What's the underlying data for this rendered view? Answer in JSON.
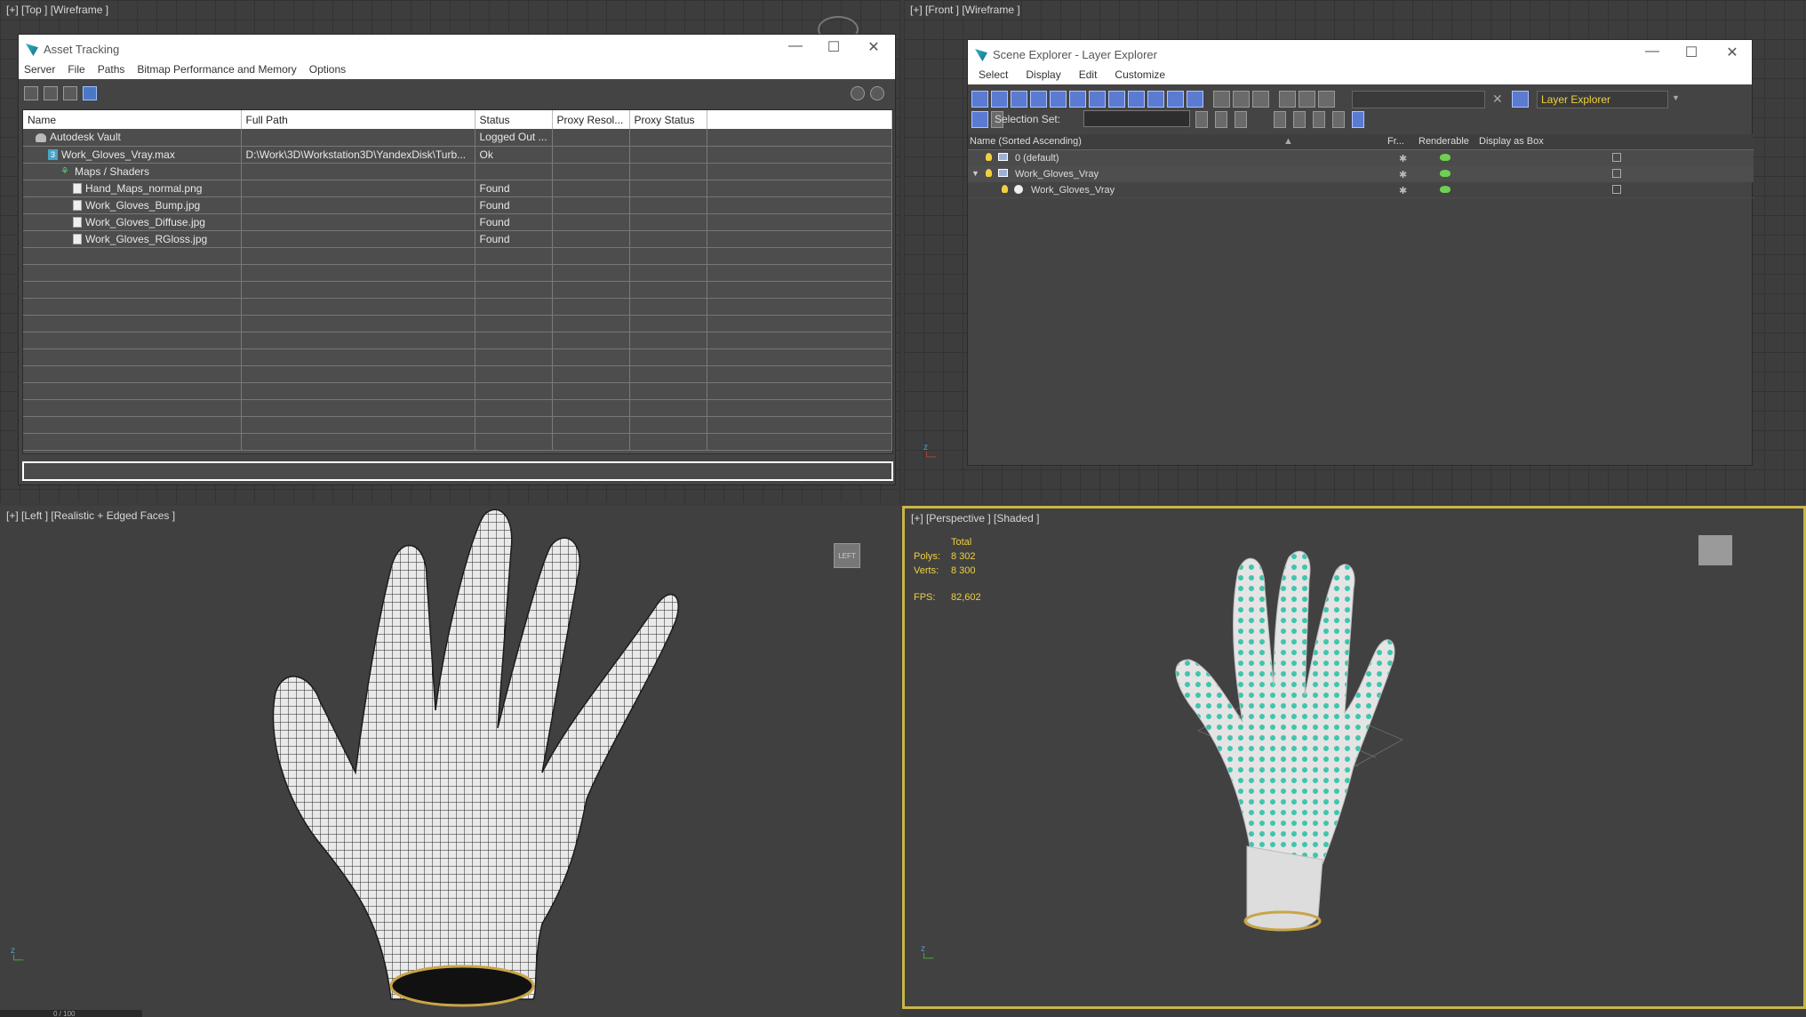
{
  "viewports": {
    "top_label": "[+] [Top ] [Wireframe ]",
    "front_label": "[+] [Front ] [Wireframe ]",
    "left_label": "[+] [Left ] [Realistic + Edged Faces ]",
    "persp_label": "[+] [Perspective ] [Shaded ]",
    "viewcube_left": "LEFT"
  },
  "asset_tracking": {
    "title": "Asset Tracking",
    "menu": [
      "Server",
      "File",
      "Paths",
      "Bitmap Performance and Memory",
      "Options"
    ],
    "columns": [
      "Name",
      "Full Path",
      "Status",
      "Proxy Resol...",
      "Proxy Status",
      ""
    ],
    "rows": [
      {
        "name": "Autodesk Vault",
        "path": "",
        "status": "Logged Out ...",
        "icon": "vault-icon",
        "indent": 1
      },
      {
        "name": "Work_Gloves_Vray.max",
        "path": "D:\\Work\\3D\\Workstation3D\\YandexDisk\\Turb...",
        "status": "Ok",
        "icon": "max-file-icon",
        "indent": 2
      },
      {
        "name": "Maps / Shaders",
        "path": "",
        "status": "",
        "icon": "shader-icon",
        "indent": 3
      },
      {
        "name": "Hand_Maps_normal.png",
        "path": "",
        "status": "Found",
        "icon": "image-file-icon",
        "indent": 4
      },
      {
        "name": "Work_Gloves_Bump.jpg",
        "path": "",
        "status": "Found",
        "icon": "image-file-icon",
        "indent": 4
      },
      {
        "name": "Work_Gloves_Diffuse.jpg",
        "path": "",
        "status": "Found",
        "icon": "image-file-icon",
        "indent": 4
      },
      {
        "name": "Work_Gloves_RGloss.jpg",
        "path": "",
        "status": "Found",
        "icon": "image-file-icon",
        "indent": 4
      }
    ]
  },
  "scene_explorer": {
    "title": "Scene Explorer - Layer Explorer",
    "menu": [
      "Select",
      "Display",
      "Edit",
      "Customize"
    ],
    "explorer_dropdown": "Layer Explorer",
    "selection_set_label": "Selection Set:",
    "columns": [
      "Name (Sorted Ascending)",
      "Fr...",
      "Renderable",
      "Display as Box"
    ],
    "rows": [
      {
        "name": "0 (default)",
        "type": "layer"
      },
      {
        "name": "Work_Gloves_Vray",
        "type": "layer"
      },
      {
        "name": "Work_Gloves_Vray",
        "type": "object"
      }
    ]
  },
  "stats": {
    "total_label": "Total",
    "polys_label": "Polys:",
    "polys_value": "8 302",
    "verts_label": "Verts:",
    "verts_value": "8 300",
    "fps_label": "FPS:",
    "fps_value": "82,602"
  },
  "timeline": "0 / 100",
  "colors": {
    "accent_yellow": "#c9b54a",
    "glove_dots": "#3fc5ac",
    "selection_blue": "#4a78c6"
  }
}
